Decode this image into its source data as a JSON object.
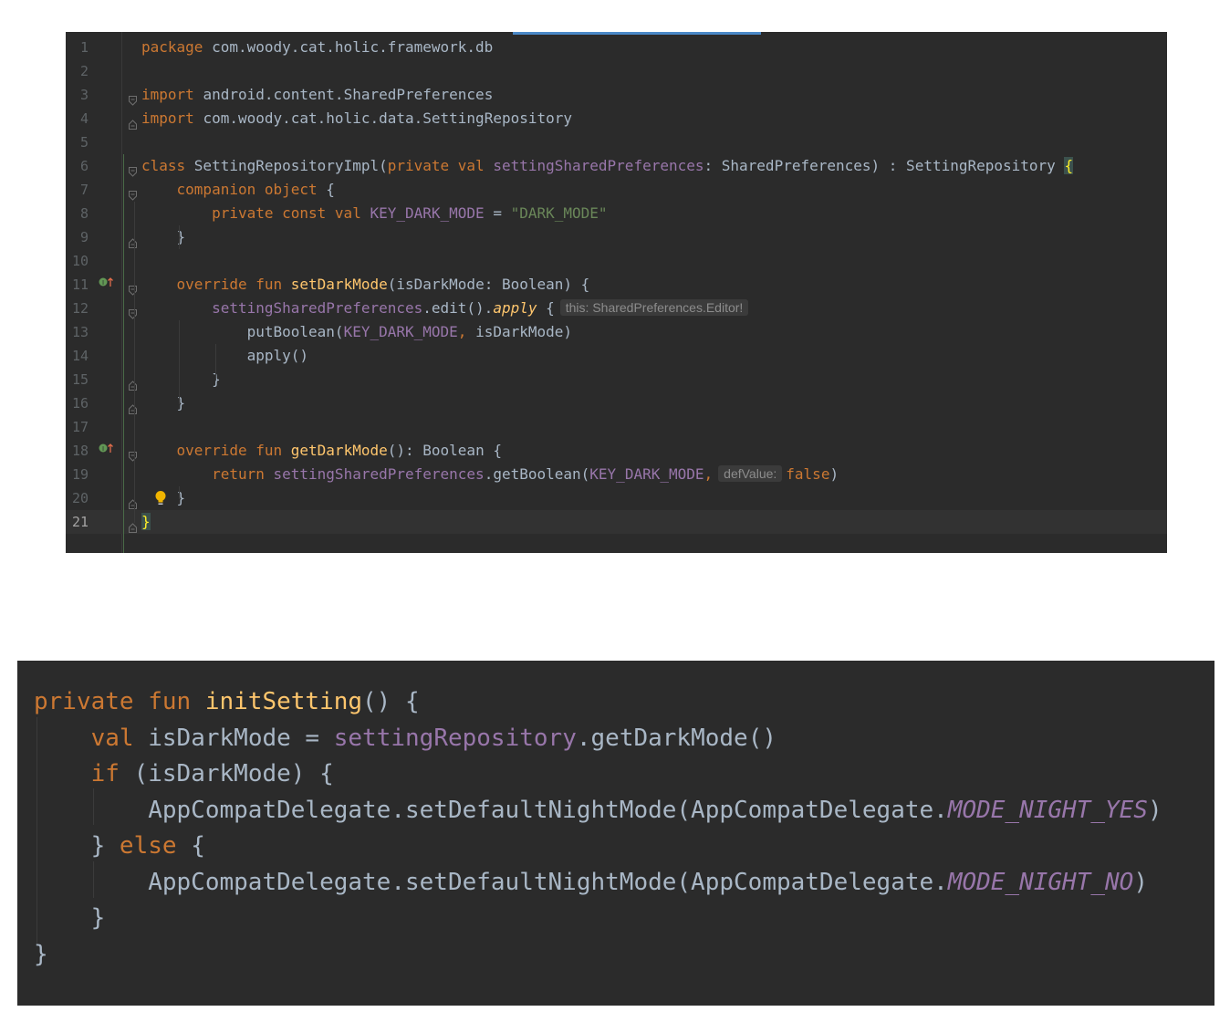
{
  "editor1": {
    "lines": [
      {
        "num": "1",
        "tokens": [
          {
            "t": "package ",
            "c": "kw"
          },
          {
            "t": "com.woody.cat.holic.framework.db"
          }
        ]
      },
      {
        "num": "2",
        "tokens": []
      },
      {
        "num": "3",
        "tokens": [
          {
            "t": "import ",
            "c": "kw"
          },
          {
            "t": "android.content.SharedPreferences"
          }
        ]
      },
      {
        "num": "4",
        "tokens": [
          {
            "t": "import ",
            "c": "kw"
          },
          {
            "t": "com.woody.cat.holic.data.SettingRepository"
          }
        ]
      },
      {
        "num": "5",
        "tokens": []
      },
      {
        "num": "6",
        "tokens": [
          {
            "t": "class ",
            "c": "kw"
          },
          {
            "t": "SettingRepositoryImpl("
          },
          {
            "t": "private val ",
            "c": "kw"
          },
          {
            "t": "settingSharedPreferences",
            "c": "prop"
          },
          {
            "t": ": SharedPreferences) : SettingRepository "
          },
          {
            "t": "{",
            "c": "brace-hl"
          }
        ]
      },
      {
        "num": "7",
        "tokens": [
          {
            "t": "    "
          },
          {
            "t": "companion object ",
            "c": "kw"
          },
          {
            "t": "{"
          }
        ]
      },
      {
        "num": "8",
        "tokens": [
          {
            "t": "        "
          },
          {
            "t": "private const val ",
            "c": "kw"
          },
          {
            "t": "KEY_DARK_MODE",
            "c": "prop"
          },
          {
            "t": " = "
          },
          {
            "t": "\"DARK_MODE\"",
            "c": "str"
          }
        ]
      },
      {
        "num": "9",
        "tokens": [
          {
            "t": "    }"
          }
        ]
      },
      {
        "num": "10",
        "tokens": []
      },
      {
        "num": "11",
        "tokens": [
          {
            "t": "    "
          },
          {
            "t": "override fun ",
            "c": "kw"
          },
          {
            "t": "setDarkMode",
            "c": "fn"
          },
          {
            "t": "(isDarkMode: Boolean) {"
          }
        ]
      },
      {
        "num": "12",
        "tokens": [
          {
            "t": "        "
          },
          {
            "t": "settingSharedPreferences",
            "c": "prop"
          },
          {
            "t": ".edit()."
          },
          {
            "t": "apply",
            "c": "fn ital"
          },
          {
            "t": " {"
          },
          {
            "hint": "this: SharedPreferences.Editor!"
          }
        ]
      },
      {
        "num": "13",
        "tokens": [
          {
            "t": "            putBoolean("
          },
          {
            "t": "KEY_DARK_MODE",
            "c": "prop"
          },
          {
            "t": ", ",
            "c": "kw"
          },
          {
            "t": "isDarkMode)"
          }
        ]
      },
      {
        "num": "14",
        "tokens": [
          {
            "t": "            apply()"
          }
        ]
      },
      {
        "num": "15",
        "tokens": [
          {
            "t": "        }"
          }
        ]
      },
      {
        "num": "16",
        "tokens": [
          {
            "t": "    }"
          }
        ]
      },
      {
        "num": "17",
        "tokens": []
      },
      {
        "num": "18",
        "tokens": [
          {
            "t": "    "
          },
          {
            "t": "override fun ",
            "c": "kw"
          },
          {
            "t": "getDarkMode",
            "c": "fn"
          },
          {
            "t": "(): Boolean {"
          }
        ]
      },
      {
        "num": "19",
        "tokens": [
          {
            "t": "        "
          },
          {
            "t": "return ",
            "c": "kw"
          },
          {
            "t": "settingSharedPreferences",
            "c": "prop"
          },
          {
            "t": ".getBoolean("
          },
          {
            "t": "KEY_DARK_MODE",
            "c": "prop"
          },
          {
            "t": ",",
            "c": "kw"
          },
          {
            "hint": "defValue:"
          },
          {
            "t": "false",
            "c": "kw"
          },
          {
            "t": ")"
          }
        ]
      },
      {
        "num": "20",
        "tokens": [
          {
            "t": "    }"
          }
        ]
      },
      {
        "num": "21",
        "tokens": [
          {
            "t": "}",
            "c": "brace-hl"
          }
        ]
      }
    ]
  },
  "editor2": {
    "lines": [
      {
        "tokens": [
          {
            "t": "private fun ",
            "c": "kw"
          },
          {
            "t": "initSetting",
            "c": "fn"
          },
          {
            "t": "() {"
          }
        ]
      },
      {
        "tokens": [
          {
            "t": "    "
          },
          {
            "t": "val ",
            "c": "kw"
          },
          {
            "t": "isDarkMode = "
          },
          {
            "t": "settingRepository",
            "c": "prop"
          },
          {
            "t": ".getDarkMode()"
          }
        ]
      },
      {
        "tokens": [
          {
            "t": "    "
          },
          {
            "t": "if ",
            "c": "kw"
          },
          {
            "t": "(isDarkMode) {"
          }
        ]
      },
      {
        "tokens": [
          {
            "t": "        AppCompatDelegate.setDefaultNightMode(AppCompatDelegate."
          },
          {
            "t": "MODE_NIGHT_YES",
            "c": "prop ital"
          },
          {
            "t": ")"
          }
        ]
      },
      {
        "tokens": [
          {
            "t": "    } "
          },
          {
            "t": "else ",
            "c": "kw"
          },
          {
            "t": "{"
          }
        ]
      },
      {
        "tokens": [
          {
            "t": "        AppCompatDelegate.setDefaultNightMode(AppCompatDelegate."
          },
          {
            "t": "MODE_NIGHT_NO",
            "c": "prop ital"
          },
          {
            "t": ")"
          }
        ]
      },
      {
        "tokens": [
          {
            "t": "    }"
          }
        ]
      },
      {
        "tokens": [
          {
            "t": "}"
          }
        ]
      }
    ]
  }
}
